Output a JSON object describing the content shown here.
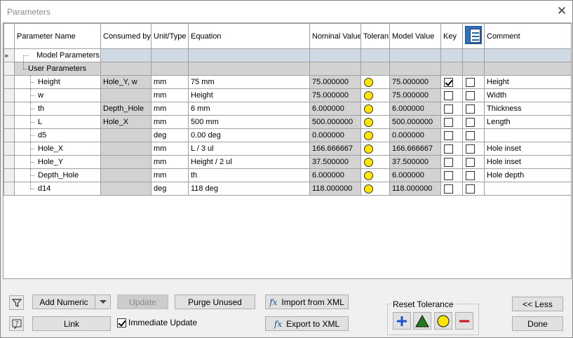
{
  "window": {
    "title": "Parameters",
    "close_glyph": "✕"
  },
  "columns": {
    "name": "Parameter Name",
    "consumed": "Consumed by",
    "unit": "Unit/Type",
    "equation": "Equation",
    "nominal": "Nominal Value",
    "tolerance": "Toleran",
    "model": "Model Value",
    "key": "Key",
    "export_icon": "export-parameter-icon",
    "comment": "Comment"
  },
  "groups": {
    "model": "Model Parameters",
    "user": "User Parameters"
  },
  "rows": [
    {
      "name": "Height",
      "consumed": "Hole_Y, w",
      "unit": "mm",
      "equation": "75 mm",
      "nominal": "75.000000",
      "model": "75.000000",
      "key": true,
      "export": false,
      "comment": "Height"
    },
    {
      "name": "w",
      "consumed": "",
      "unit": "mm",
      "equation": "Height",
      "nominal": "75.000000",
      "model": "75.000000",
      "key": false,
      "export": false,
      "comment": "Width"
    },
    {
      "name": "th",
      "consumed": "Depth_Hole",
      "unit": "mm",
      "equation": "6 mm",
      "nominal": "6.000000",
      "model": "6.000000",
      "key": false,
      "export": false,
      "comment": "Thickness"
    },
    {
      "name": "L",
      "consumed": "Hole_X",
      "unit": "mm",
      "equation": "500 mm",
      "nominal": "500.000000",
      "model": "500.000000",
      "key": false,
      "export": false,
      "comment": "Length"
    },
    {
      "name": "d5",
      "consumed": "",
      "unit": "deg",
      "equation": "0.00 deg",
      "nominal": "0.000000",
      "model": "0.000000",
      "key": false,
      "export": false,
      "comment": ""
    },
    {
      "name": "Hole_X",
      "consumed": "",
      "unit": "mm",
      "equation": "L / 3 ul",
      "nominal": "166.666667",
      "model": "166.666667",
      "key": false,
      "export": false,
      "comment": "Hole inset"
    },
    {
      "name": "Hole_Y",
      "consumed": "",
      "unit": "mm",
      "equation": "Height / 2 ul",
      "nominal": "37.500000",
      "model": "37.500000",
      "key": false,
      "export": false,
      "comment": "Hole inset"
    },
    {
      "name": "Depth_Hole",
      "consumed": "",
      "unit": "mm",
      "equation": "th",
      "nominal": "6.000000",
      "model": "6.000000",
      "key": false,
      "export": false,
      "comment": "Hole depth"
    },
    {
      "name": "d14",
      "consumed": "",
      "unit": "deg",
      "equation": "118 deg",
      "nominal": "118.000000",
      "model": "118.000000",
      "key": false,
      "export": false,
      "comment": ""
    }
  ],
  "toolbar": {
    "add_numeric": "Add Numeric",
    "update": "Update",
    "purge_unused": "Purge Unused",
    "import_xml": "Import from XML",
    "export_xml": "Export to XML",
    "link": "Link",
    "immediate_update": "Immediate Update",
    "immediate_update_checked": true,
    "reset_tolerance": "Reset Tolerance",
    "less": "<< Less",
    "done": "Done",
    "fx_glyph": "fx"
  },
  "colors": {
    "tol_upper": "#1f4fcf",
    "tol_nominal": "#1f7a1f",
    "tol_median": "#ffe600",
    "tol_lower": "#d0101a",
    "group_row": "#d0dae4",
    "readonly_cell": "#d3d3d3"
  }
}
